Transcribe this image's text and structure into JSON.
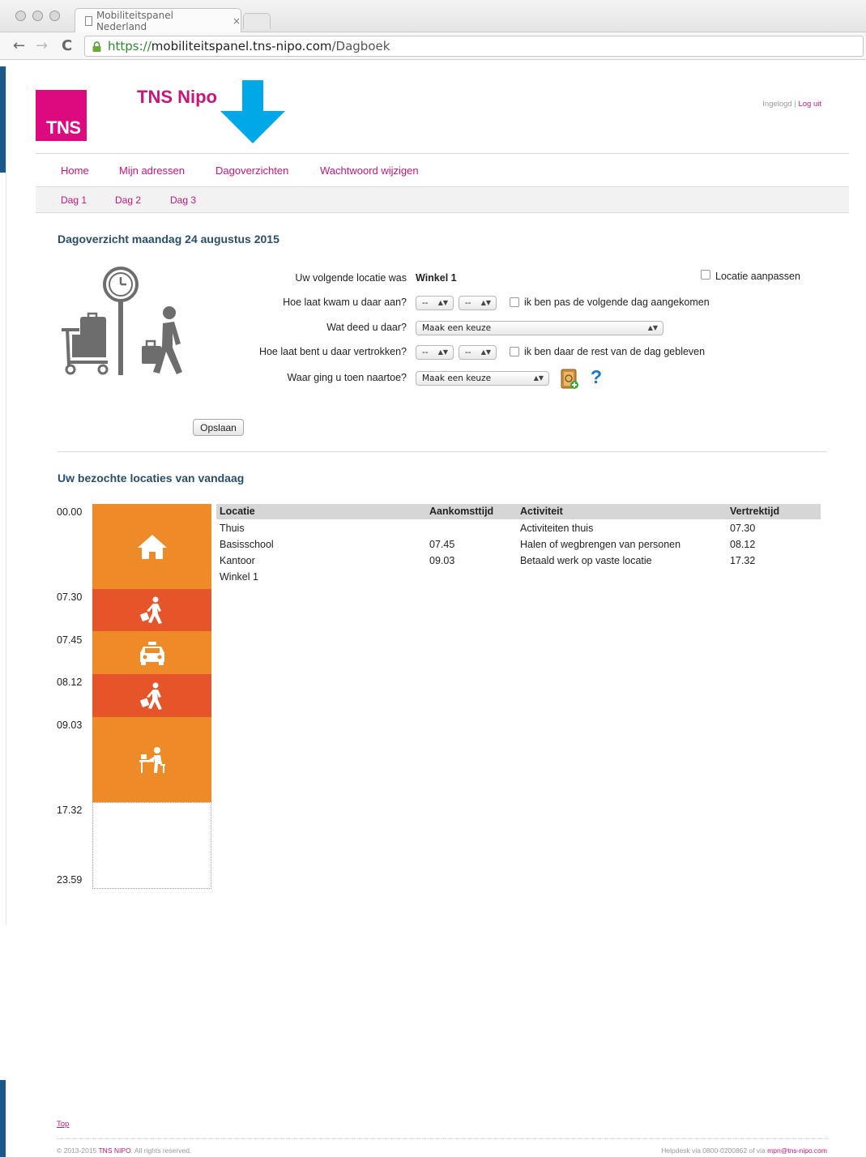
{
  "browser": {
    "tab_title": "Mobiliteitspanel Nederland",
    "tab_close": "×",
    "url_scheme": "https://",
    "url_host": "mobiliteitspanel.tns-nipo.com",
    "url_path": "/Dagboek",
    "back_glyph": "←",
    "forward_glyph": "→",
    "reload_glyph": "C"
  },
  "header": {
    "logo_text": "TNS",
    "brand": "TNS Nipo",
    "logged_in": "Ingelogd",
    "separator": " | ",
    "logout": "Log uit",
    "annotation_color": "#00a8e8"
  },
  "main_menu": [
    "Home",
    "Mijn adressen",
    "Dagoverzichten",
    "Wachtwoord wijzigen"
  ],
  "sub_menu": [
    "Dag 1",
    "Dag 2",
    "Dag 3"
  ],
  "day_overview": {
    "title": "Dagoverzicht maandag 24 augustus 2015",
    "next_location_label": "Uw volgende locatie was",
    "next_location_value": "Winkel 1",
    "adjust_location_label": "Locatie aanpassen",
    "arrival_label": "Hoe laat kwam u daar aan?",
    "arrival_hour": "--",
    "arrival_minute": "--",
    "arrival_next_day_label": "ik ben pas de volgende dag aangekomen",
    "activity_label": "Wat deed u daar?",
    "activity_value": "Maak een keuze",
    "departure_label": "Hoe laat bent u daar vertrokken?",
    "departure_hour": "--",
    "departure_minute": "--",
    "stayed_rest_of_day_label": "ik ben daar de rest van de dag gebleven",
    "destination_label": "Waar ging u toen naartoe?",
    "destination_value": "Maak een keuze",
    "help_glyph": "?",
    "save_label": "Opslaan"
  },
  "visited": {
    "title": "Uw bezochte locaties van vandaag",
    "timeline_labels": [
      "00.00",
      "07.30",
      "07.45",
      "08.12",
      "09.03",
      "17.32",
      "23.59"
    ],
    "timeline_segments": [
      {
        "icon": "house-icon",
        "color": "#ef8a29"
      },
      {
        "icon": "walking-traveler-icon",
        "color": "#e6552a"
      },
      {
        "icon": "car-icon",
        "color": "#ef8a29"
      },
      {
        "icon": "walking-traveler-icon",
        "color": "#e6552a"
      },
      {
        "icon": "desk-worker-icon",
        "color": "#ef8a29"
      },
      {
        "icon": "empty-period",
        "color": "#ffffff"
      }
    ],
    "columns": {
      "location": "Locatie",
      "arrival": "Aankomsttijd",
      "activity": "Activiteit",
      "departure": "Vertrektijd"
    },
    "rows": [
      {
        "location": "Thuis",
        "arrival": "",
        "activity": "Activiteiten thuis",
        "departure": "07.30"
      },
      {
        "location": "Basisschool",
        "arrival": "07.45",
        "activity": "Halen of wegbrengen van personen",
        "departure": "08.12"
      },
      {
        "location": "Kantoor",
        "arrival": "09.03",
        "activity": "Betaald werk op vaste locatie",
        "departure": "17.32"
      },
      {
        "location": "Winkel 1",
        "arrival": "",
        "activity": "",
        "departure": ""
      }
    ]
  },
  "footer": {
    "top_link": "Top",
    "copyright_prefix": "© 2013-2015 ",
    "copyright_brand": "TNS NIPO",
    "copyright_suffix": ". All rights reserved.",
    "helpdesk_prefix": "Helpdesk via 0800-0200862 of via ",
    "helpdesk_email": "mpn@tns-nipo.com"
  },
  "colors": {
    "brand_pink": "#c8157a",
    "logo_magenta": "#dc0a7e",
    "heading_blue": "#2a4e6b",
    "orange": "#ef8a29",
    "red_orange": "#e6552a"
  }
}
